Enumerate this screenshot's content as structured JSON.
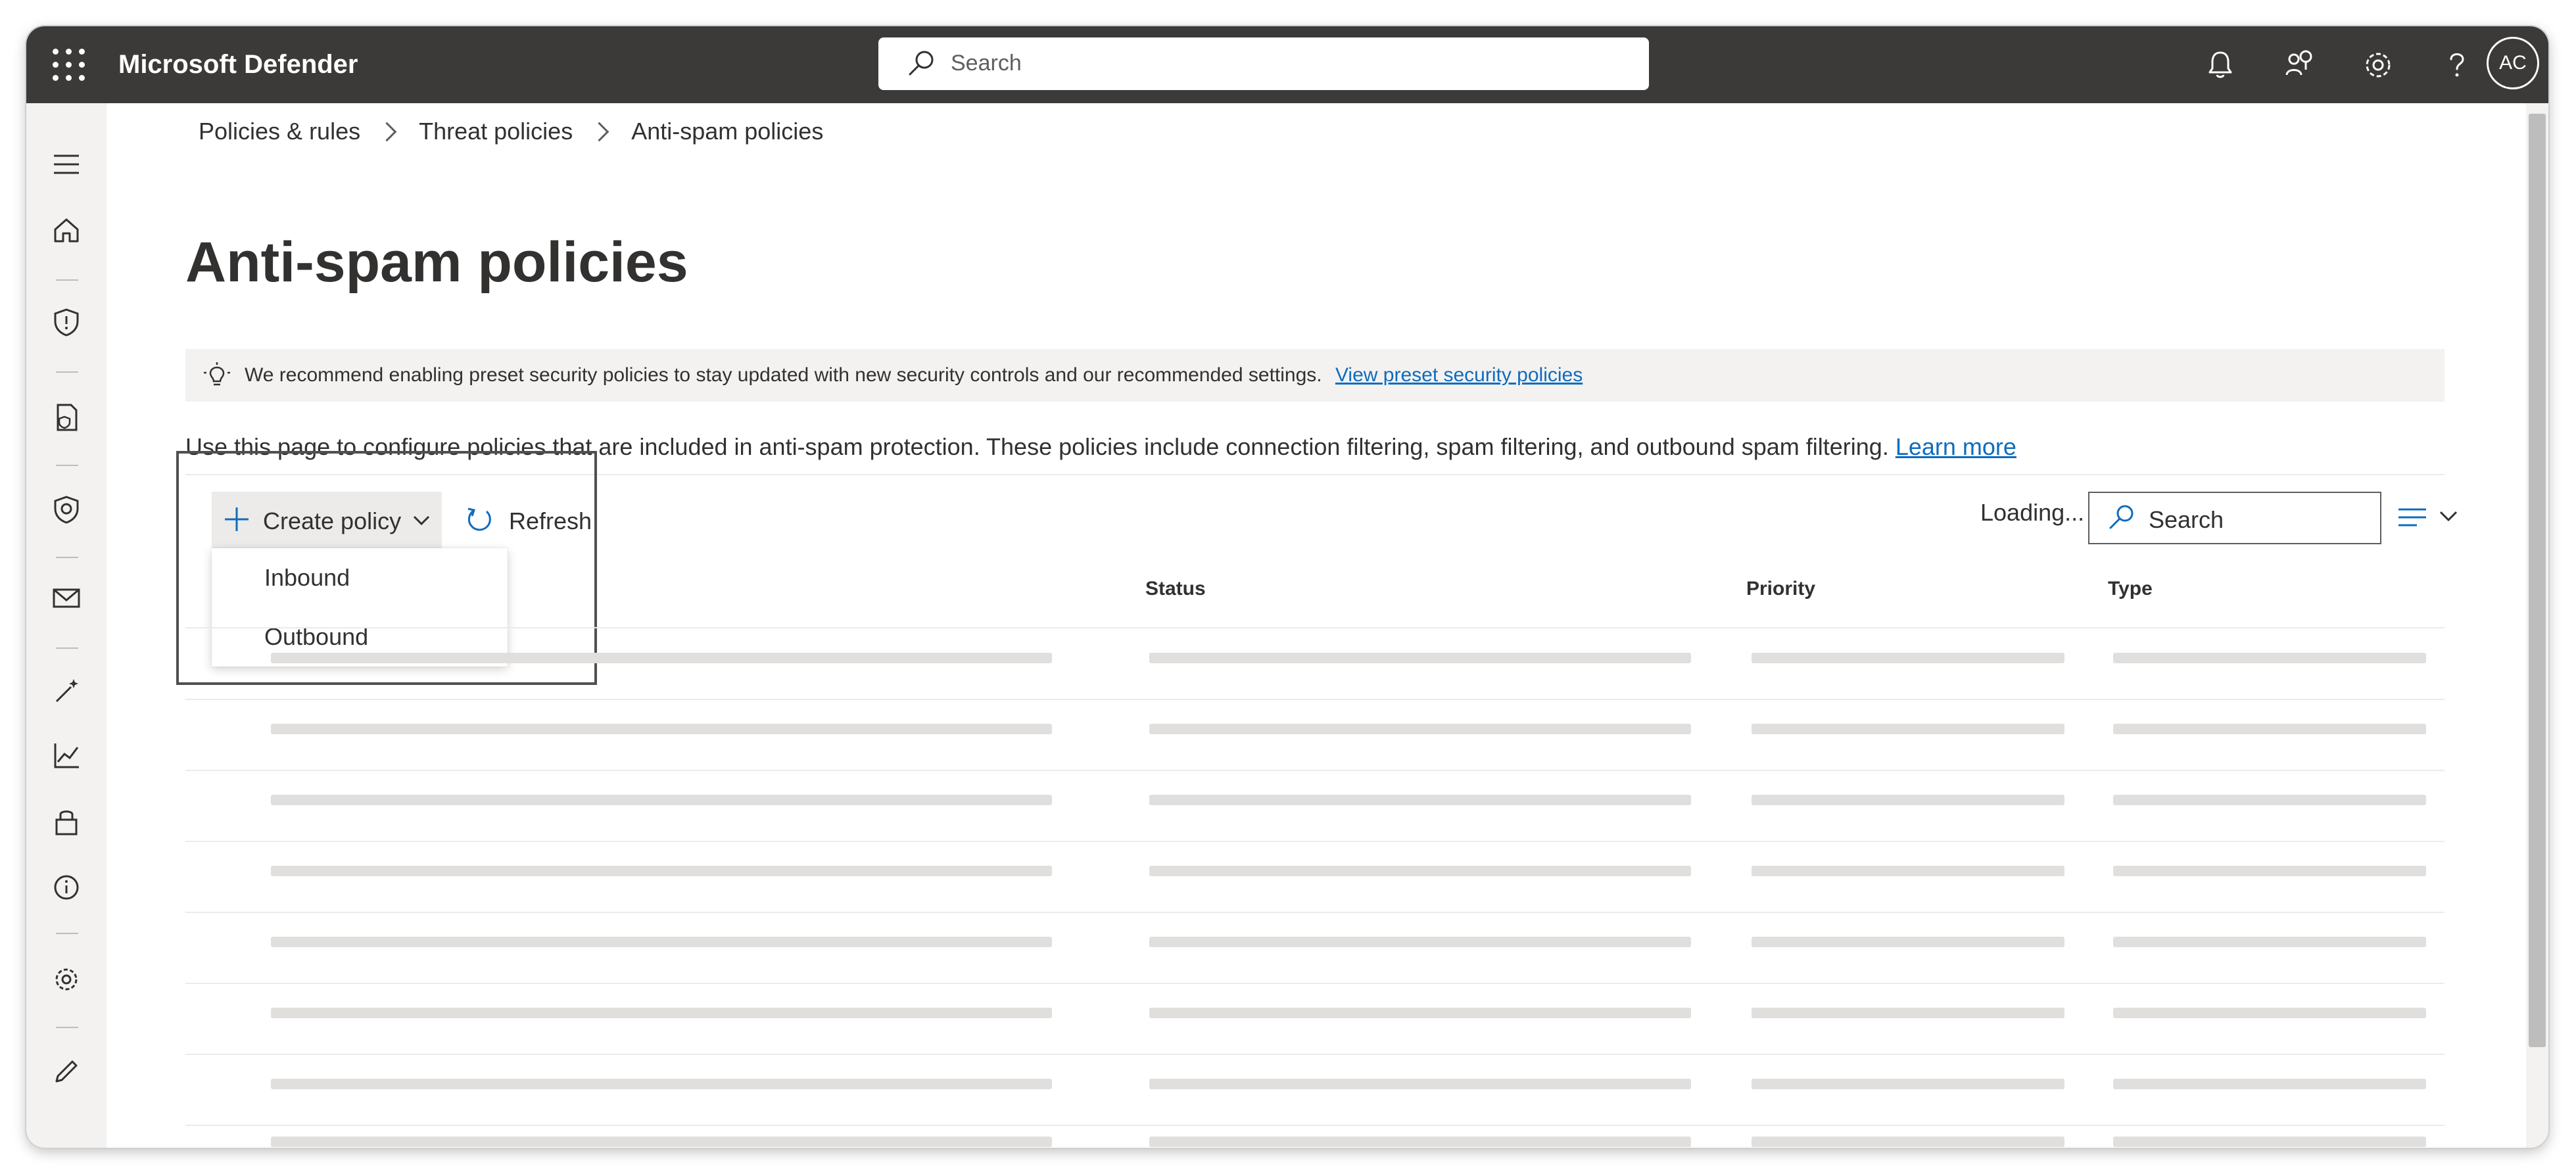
{
  "app": {
    "title": "Microsoft Defender",
    "avatar_initials": "AC"
  },
  "topbar": {
    "search_placeholder": "Search",
    "icons": [
      "notifications-icon",
      "community-icon",
      "settings-icon",
      "help-icon"
    ]
  },
  "leftnav": {
    "icons": [
      "hamburger-icon",
      "home-icon",
      "shield-icon",
      "document-shield-icon",
      "security-icon",
      "mail-icon",
      "magic-wand-icon",
      "chart-icon",
      "partner-icon",
      "info-icon",
      "settings-icon",
      "edit-icon"
    ]
  },
  "breadcrumb": {
    "items": [
      "Policies & rules",
      "Threat policies",
      "Anti-spam policies"
    ]
  },
  "page": {
    "title": "Anti-spam policies",
    "recommendation": "We recommend enabling preset security policies to stay updated with new security controls and our recommended settings.",
    "recommendation_link": "View preset security policies",
    "description": "Use this page to configure policies that are included in anti-spam protection. These policies include connection filtering, spam filtering, and outbound spam filtering.",
    "description_link": "Learn more"
  },
  "toolbar": {
    "create_label": "Create policy",
    "refresh_label": "Refresh",
    "loading_text": "Loading...",
    "search_placeholder": "Search"
  },
  "dropdown": {
    "items": [
      "Inbound",
      "Outbound"
    ]
  },
  "table": {
    "columns": [
      "Status",
      "Priority",
      "Type"
    ]
  },
  "colors": {
    "topbar": "#3b3a39",
    "link": "#0f6cbd",
    "skeleton": "#e1dfdd"
  }
}
